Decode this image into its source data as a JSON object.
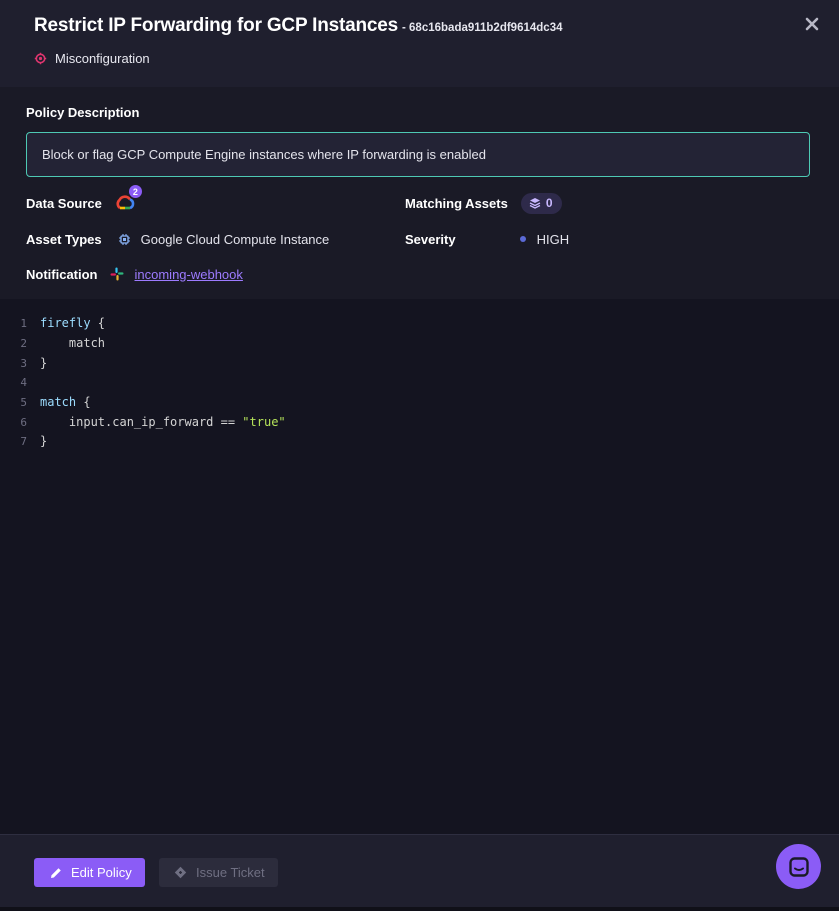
{
  "header": {
    "title": "Restrict IP Forwarding for GCP Instances",
    "policy_id": "- 68c16bada911b2df9614dc34",
    "category": "Misconfiguration",
    "close_icon": "close-icon"
  },
  "details": {
    "description_label": "Policy Description",
    "description": "Block or flag GCP Compute Engine instances where IP forwarding is enabled",
    "data_source_label": "Data Source",
    "data_source_count": "2",
    "data_source_icon": "google-cloud-icon",
    "matching_assets_label": "Matching Assets",
    "matching_assets_count": "0",
    "asset_types_label": "Asset Types",
    "asset_type": "Google Cloud Compute Instance",
    "severity_label": "Severity",
    "severity": "HIGH",
    "notification_label": "Notification",
    "notification": "incoming-webhook",
    "notification_icon": "slack-icon"
  },
  "code": {
    "line_numbers": [
      "1",
      "2",
      "3",
      "4",
      "5",
      "6",
      "7"
    ],
    "l1_kw": "firefly",
    "l1_rest": " {",
    "l2": "    match",
    "l3": "}",
    "l4": "",
    "l5_kw": "match",
    "l5_rest": " {",
    "l6_pre": "    input.can_ip_forward == ",
    "l6_str": "\"true\"",
    "l7": "}"
  },
  "footer": {
    "edit_label": "Edit Policy",
    "ticket_label": "Issue Ticket"
  },
  "colors": {
    "accent": "#8b5cf6",
    "description_border": "#4ec9b4",
    "severity_dot": "#5b6ad6",
    "category_icon": "#e0356f"
  }
}
